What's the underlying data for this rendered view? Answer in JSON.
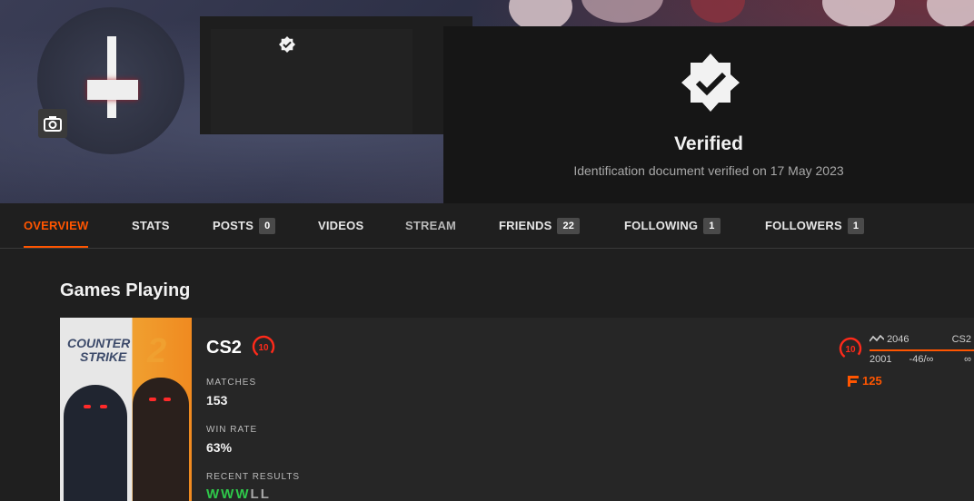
{
  "profile": {
    "verified_title": "Verified",
    "verified_subtitle": "Identification document verified on 17 May 2023"
  },
  "tabs": [
    {
      "label": "OVERVIEW",
      "count": null,
      "active": true
    },
    {
      "label": "STATS",
      "count": null
    },
    {
      "label": "POSTS",
      "count": "0"
    },
    {
      "label": "VIDEOS",
      "count": null
    },
    {
      "label": "STREAM",
      "count": null
    },
    {
      "label": "FRIENDS",
      "count": "22"
    },
    {
      "label": "FOLLOWING",
      "count": "1"
    },
    {
      "label": "FOLLOWERS",
      "count": "1"
    }
  ],
  "games": {
    "section_title": "Games Playing",
    "card": {
      "cover_line1": "COUNTER",
      "cover_line2": "STRIKE",
      "cover_number": "2",
      "name": "CS2",
      "level": "10",
      "matches_label": "MATCHES",
      "matches_value": "153",
      "winrate_label": "WIN RATE",
      "winrate_value": "63%",
      "recent_label": "RECENT RESULTS",
      "recent_results": [
        "W",
        "W",
        "W",
        "L",
        "L"
      ],
      "elo": {
        "level": "10",
        "current": "2046",
        "game": "CS2",
        "range_low": "2001",
        "range_diff": "-46/∞",
        "range_high": "∞",
        "points": "125"
      }
    }
  },
  "colors": {
    "accent": "#ff5500",
    "win": "#2ec84a",
    "loss": "#a8a8a8"
  }
}
